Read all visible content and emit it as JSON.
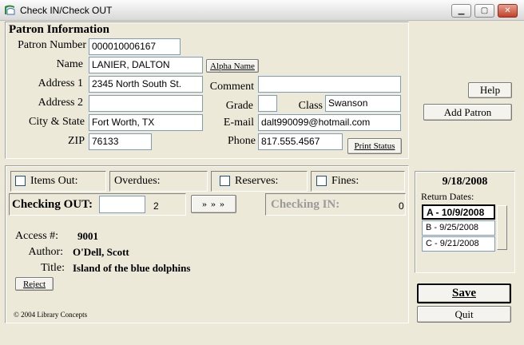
{
  "window": {
    "title": "Check IN/Check OUT"
  },
  "patron": {
    "heading": "Patron Information",
    "number_label": "Patron Number",
    "number": "000010006167",
    "name_label": "Name",
    "name": "LANIER, DALTON",
    "alpha_name_button": "Alpha Name",
    "address1_label": "Address 1",
    "address1": "2345 North South St.",
    "address2_label": "Address 2",
    "address2": "",
    "city_state_label": "City & State",
    "city_state": "Fort Worth, TX",
    "zip_label": "ZIP",
    "zip": "76133",
    "comment_label": "Comment",
    "comment": "",
    "grade_label": "Grade",
    "grade": "",
    "class_label": "Class",
    "class": "Swanson",
    "email_label": "E-mail",
    "email": "dalt990099@hotmail.com",
    "phone_label": "Phone",
    "phone": "817.555.4567",
    "print_status_button": "Print Status"
  },
  "side_buttons": {
    "help": "Help",
    "add_patron": "Add Patron"
  },
  "status": {
    "items_out": "Items Out:",
    "overdues": "Overdues:",
    "reserves": "Reserves:",
    "fines": "Fines:"
  },
  "checking": {
    "out_label": "Checking OUT:",
    "out_value": "",
    "out_count": "2",
    "arrow_button": "» » »",
    "in_label": "Checking IN:",
    "in_count": "0"
  },
  "item": {
    "access_label": "Access #:",
    "access": "9001",
    "author_label": "Author:",
    "author": "O'Dell, Scott",
    "title_label": "Title:",
    "title": "Island of the blue dolphins",
    "reject_button": "Reject"
  },
  "dates": {
    "current": "9/18/2008",
    "return_label": "Return Dates:",
    "options": [
      "A - 10/9/2008",
      "B - 9/25/2008",
      "C - 9/21/2008"
    ]
  },
  "actions": {
    "save": "Save",
    "quit": "Quit"
  },
  "footer": {
    "copyright": "© 2004 Library Concepts"
  }
}
